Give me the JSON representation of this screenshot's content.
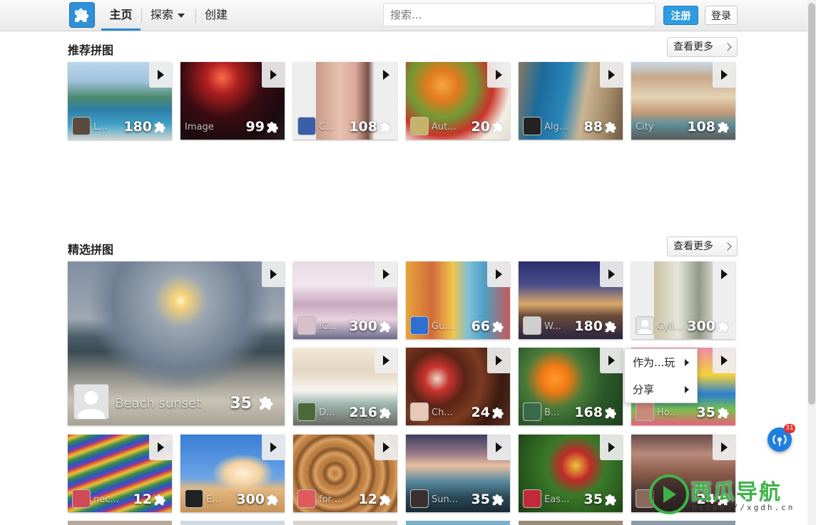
{
  "header": {
    "nav_home": "主页",
    "nav_explore": "探索",
    "nav_create": "创建",
    "search_placeholder": "搜索...",
    "register": "注册",
    "login": "登录"
  },
  "sections": {
    "recommended": {
      "title": "推荐拼图",
      "more": "查看更多"
    },
    "featured": {
      "title": "精选拼图",
      "more": "查看更多"
    }
  },
  "recommended_tiles": [
    {
      "title": "L...",
      "count": "180"
    },
    {
      "title": "Image",
      "count": "99"
    },
    {
      "title": "C...",
      "count": "108"
    },
    {
      "title": "Aut...",
      "count": "20"
    },
    {
      "title": "Alg...",
      "count": "88"
    },
    {
      "title": "City",
      "count": "108"
    }
  ],
  "featured_big": {
    "title": "Beach sunset",
    "count": "35"
  },
  "featured_tiles": [
    {
      "title": "IC...",
      "count": "300"
    },
    {
      "title": "Gu...",
      "count": "66"
    },
    {
      "title": "W...",
      "count": "180"
    },
    {
      "title": "Cyli...",
      "count": "300"
    },
    {
      "title": "D...",
      "count": "216"
    },
    {
      "title": "Ch...",
      "count": "24"
    },
    {
      "title": "B...",
      "count": "168"
    },
    {
      "title": "Ho...",
      "count": "35"
    },
    {
      "title": "nec...",
      "count": "12"
    },
    {
      "title": "E...",
      "count": "300"
    },
    {
      "title": "for ...",
      "count": "12"
    },
    {
      "title": "Sun...",
      "count": "35"
    },
    {
      "title": "Eas...",
      "count": "35"
    },
    {
      "title": "",
      "count": "24"
    }
  ],
  "context_menu": {
    "play_as": "作为...玩",
    "share": "分享"
  },
  "notification_badge": "31",
  "watermark": {
    "text": "西瓜导航",
    "url": "https://xgdh.cn"
  }
}
